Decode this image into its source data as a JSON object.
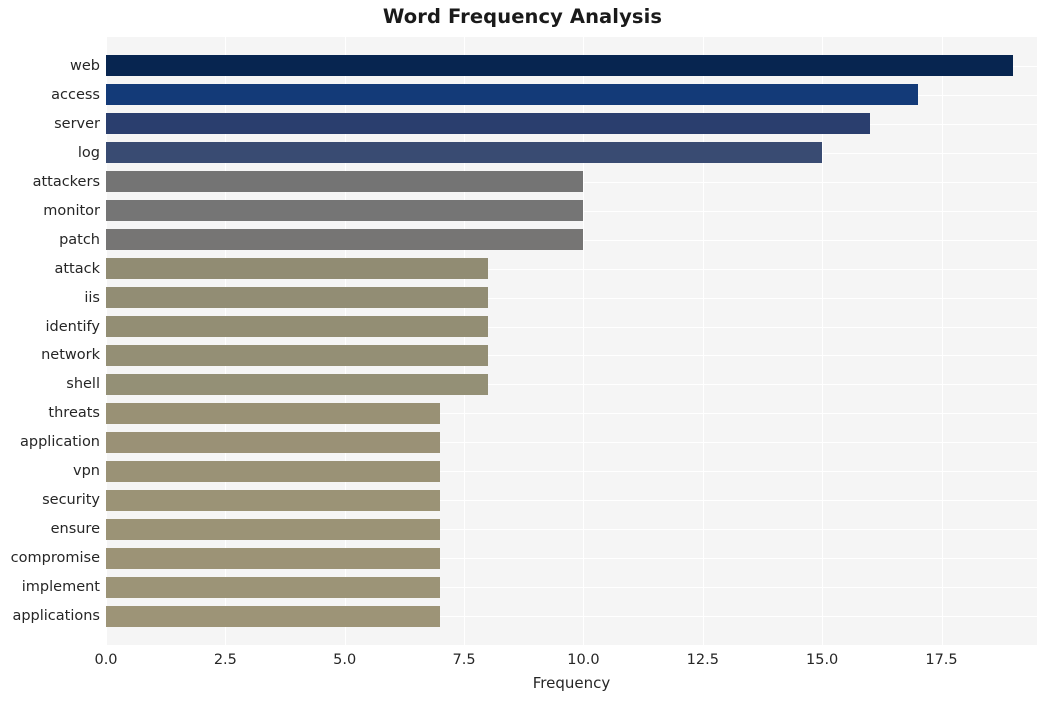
{
  "chart_data": {
    "type": "bar",
    "orientation": "horizontal",
    "title": "Word Frequency Analysis",
    "xlabel": "Frequency",
    "ylabel": "",
    "xlim": [
      0,
      19.5
    ],
    "grid": true,
    "legend": null,
    "xticks": [
      "0.0",
      "2.5",
      "5.0",
      "7.5",
      "10.0",
      "12.5",
      "15.0",
      "17.5"
    ],
    "xtick_values": [
      0.0,
      2.5,
      5.0,
      7.5,
      10.0,
      12.5,
      15.0,
      17.5
    ],
    "categories": [
      "web",
      "access",
      "server",
      "log",
      "attackers",
      "monitor",
      "patch",
      "attack",
      "iis",
      "identify",
      "network",
      "shell",
      "threats",
      "application",
      "vpn",
      "security",
      "ensure",
      "compromise",
      "implement",
      "applications"
    ],
    "values": [
      19,
      17,
      16,
      15,
      10,
      10,
      10,
      8,
      8,
      8,
      8,
      8,
      7,
      7,
      7,
      7,
      7,
      7,
      7,
      7
    ],
    "bar_colors": [
      "#072550",
      "#133a78",
      "#2a3e6e",
      "#394b72",
      "#747474",
      "#757575",
      "#767574",
      "#918c73",
      "#928d74",
      "#938e74",
      "#948f75",
      "#949076",
      "#999175",
      "#9a9176",
      "#9a9276",
      "#9b9376",
      "#9b9376",
      "#9c9376",
      "#9c9477",
      "#9d9477"
    ],
    "plot_background": "#f5f5f5",
    "figure_background": "#ffffff",
    "gridline_color": "#ffffff"
  }
}
